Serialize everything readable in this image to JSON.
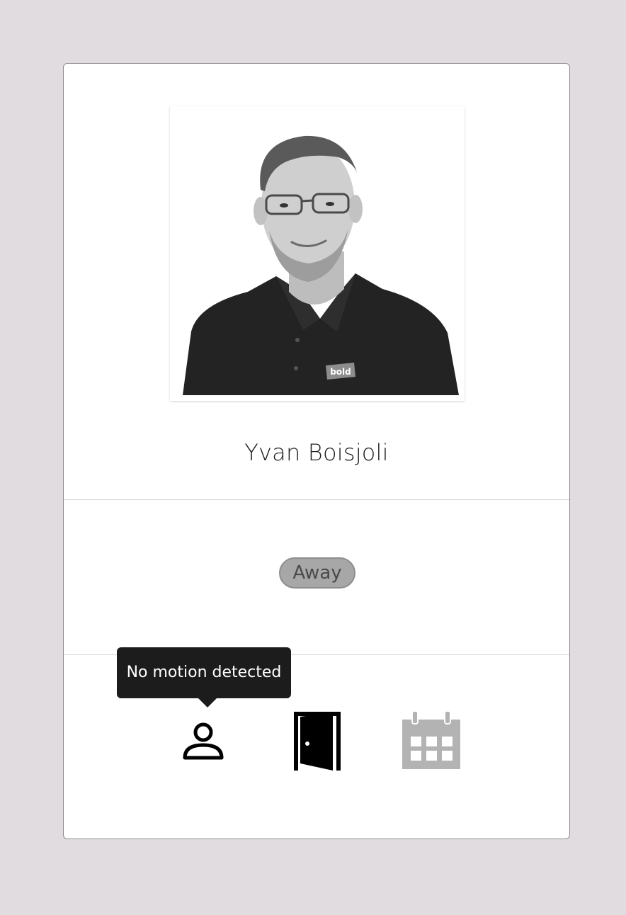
{
  "profile": {
    "name": "Yvan Boisjoli",
    "shirt_logo_text": "bold"
  },
  "status": {
    "label": "Away"
  },
  "tooltip": {
    "text": "No motion detected"
  },
  "sensors": [
    {
      "icon": "person-icon",
      "state": "active"
    },
    {
      "icon": "door-open-icon",
      "state": "active"
    },
    {
      "icon": "calendar-icon",
      "state": "inactive"
    }
  ],
  "colors": {
    "page_background": "#e0dcdf",
    "card_background": "#ffffff",
    "badge_background": "#a7a7a7",
    "tooltip_background": "#1c1c1c",
    "active_icon": "#000000",
    "inactive_icon": "#b3b3b3"
  }
}
